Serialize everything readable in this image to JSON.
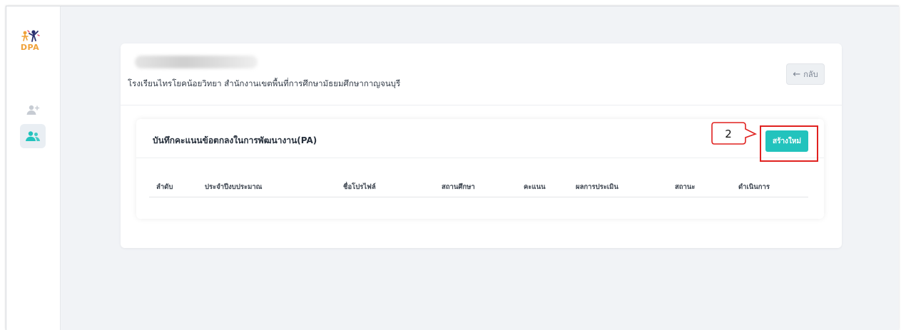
{
  "logo": {
    "text": "DPA"
  },
  "sidebar": {
    "items": [
      {
        "name": "add-user",
        "active": false
      },
      {
        "name": "users",
        "active": true
      }
    ]
  },
  "header": {
    "school_line": "โรงเรียนไทรโยคน้อยวิทยา สำนักงานเขตพื้นที่การศึกษามัธยมศึกษากาญจนบุรี",
    "back_label": "กลับ"
  },
  "panel": {
    "title": "บันทึกคะแนนข้อตกลงในการพัฒนางาน(PA)",
    "create_label": "สร้างใหม่",
    "columns": [
      "ลำดับ",
      "ประจำปีงบประมาณ",
      "ชื่อโปรไฟล์",
      "สถานศึกษา",
      "คะแนน",
      "ผลการประเมิน",
      "สถานะ",
      "ดำเนินการ"
    ],
    "rows": []
  },
  "annotation": {
    "step_number": "2"
  },
  "colors": {
    "accent": "#22c3bd",
    "highlight": "#e0211f",
    "background": "#f1f3f6"
  }
}
